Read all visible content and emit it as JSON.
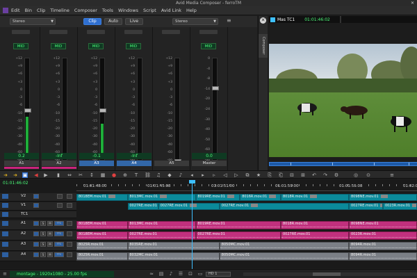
{
  "window": {
    "title": "Avid Media Composer - ferroTM"
  },
  "menu": [
    "Edit",
    "Bin",
    "Clip",
    "Timeline",
    "Composer",
    "Tools",
    "Windows",
    "Script",
    "Avid Link",
    "Help"
  ],
  "mixer": {
    "mode_left": "Stereo",
    "mode_right": "Stereo",
    "buttons": [
      "Clip",
      "Auto",
      "Live"
    ],
    "active_button": "Clip",
    "scale": [
      "+12",
      "+9",
      "+6",
      "+3",
      "0",
      "-3",
      "-6",
      "-10",
      "-15",
      "-20",
      "-30",
      "-40",
      "-60",
      "-oo"
    ],
    "master_scale": [
      "0",
      "-4",
      "-8",
      "-14",
      "-20",
      "-24",
      "-30",
      "-40",
      "-50",
      "-60",
      "-oo"
    ],
    "strips": [
      {
        "mode": "MID",
        "value": "0.2",
        "name": "A1",
        "selected": false,
        "fader": 0.5,
        "level": 0.42,
        "colored": true
      },
      {
        "mode": "MID",
        "value": "-Inf",
        "name": "A2",
        "selected": false,
        "fader": 0.05,
        "level": 0.0,
        "colored": true
      },
      {
        "mode": "MID",
        "value": "-0.1",
        "name": "A3",
        "selected": true,
        "fader": 0.5,
        "level": 0.35,
        "colored": false
      },
      {
        "mode": "MID",
        "value": "-Inf",
        "name": "A4",
        "selected": true,
        "fader": 0.05,
        "level": 0.0,
        "colored": false
      },
      {
        "mode": "",
        "value": "",
        "name": "A5",
        "selected": false,
        "fader": 0.0,
        "level": 0.0,
        "colored": false
      },
      {
        "mode": "MID",
        "value": "0.0",
        "name": "Master",
        "selected": false,
        "fader": 0.72,
        "level": 0.0,
        "colored": false
      }
    ]
  },
  "composer": {
    "tab": "Composer",
    "track": "Mas TC1",
    "timecode": "01:01:46:02"
  },
  "timeline": {
    "timecode": "01:01:46:02",
    "ruler": [
      "01:01:48:00",
      "01:01:45:08",
      "01:01:51:00",
      "01:01:59:00",
      "01:01:55:08",
      "01:02:00"
    ],
    "tracks": [
      {
        "name": "V2",
        "kind": "video",
        "clips": [
          {
            "label": "8018EM.mov.01",
            "start": 0.0,
            "end": 0.15
          },
          {
            "label": "8013MC.mov.01",
            "start": 0.15,
            "end": 0.35
          },
          {
            "label": "8019RE.mov.01",
            "start": 0.35,
            "end": 0.48
          },
          {
            "label": "8016R.mov.01",
            "start": 0.48,
            "end": 0.6
          },
          {
            "label": "8018R.mov.01",
            "start": 0.6,
            "end": 0.8
          },
          {
            "label": "8098NE.mov.01",
            "start": 0.8,
            "end": 1.0
          }
        ]
      },
      {
        "name": "V1",
        "kind": "video",
        "clips": [
          {
            "label": "0027RE.mov.01",
            "start": 0.15,
            "end": 0.24
          },
          {
            "label": "0027RE.mov.01",
            "start": 0.24,
            "end": 0.42
          },
          {
            "label": "0027RE.mov.01",
            "start": 0.42,
            "end": 0.8
          },
          {
            "label": "0027RE.mov.01",
            "start": 0.8,
            "end": 0.9
          },
          {
            "label": "0023R.mov.01",
            "start": 0.9,
            "end": 1.0
          }
        ]
      },
      {
        "name": "TC1",
        "kind": "timecode",
        "clips": []
      },
      {
        "name": "A1",
        "kind": "audio",
        "clips": [
          {
            "label": "8018EM.mov.01",
            "start": 0.0,
            "end": 0.15
          },
          {
            "label": "8013MC.mov.01",
            "start": 0.15,
            "end": 0.35
          },
          {
            "label": "8019RE.mov.01",
            "start": 0.35,
            "end": 0.6
          },
          {
            "label": "8018R.mov.01",
            "start": 0.6,
            "end": 0.8
          },
          {
            "label": "8098NE.mov.01",
            "start": 0.8,
            "end": 1.0
          }
        ]
      },
      {
        "name": "A2",
        "kind": "audio",
        "clips": [
          {
            "label": "8018EM.mov.01",
            "start": 0.0,
            "end": 0.15
          },
          {
            "label": "0027RE.mov.01",
            "start": 0.15,
            "end": 0.35
          },
          {
            "label": "0027RE.mov.01",
            "start": 0.35,
            "end": 0.6
          },
          {
            "label": "0027RE.mov.01",
            "start": 0.6,
            "end": 0.8
          },
          {
            "label": "0023R.mov.01",
            "start": 0.8,
            "end": 1.0
          }
        ]
      },
      {
        "name": "A3",
        "kind": "audio-grey",
        "clips": [
          {
            "label": "8025R.mov.01",
            "start": 0.0,
            "end": 0.15
          },
          {
            "label": "8035RE.mov.01",
            "start": 0.15,
            "end": 0.42
          },
          {
            "label": "8050MC.mov.01",
            "start": 0.42,
            "end": 0.8
          },
          {
            "label": "8094R.mov.01",
            "start": 0.8,
            "end": 1.0
          }
        ]
      },
      {
        "name": "A4",
        "kind": "audio-grey",
        "clips": [
          {
            "label": "8025R.mov.01",
            "start": 0.0,
            "end": 0.15
          },
          {
            "label": "8032MC.mov.01",
            "start": 0.15,
            "end": 0.42
          },
          {
            "label": "8050MC.mov.01",
            "start": 0.42,
            "end": 0.8
          },
          {
            "label": "8094R.mov.01",
            "start": 0.8,
            "end": 1.0
          }
        ]
      }
    ],
    "track_buttons": [
      "S",
      "M",
      "TTC"
    ]
  },
  "sequence": {
    "info": "montage - 1920x1080 - 25.00 fps",
    "zoom_label": "HD 1"
  },
  "colors": {
    "accent": "#2f6fd0",
    "video": "#0b8a9a",
    "audio": "#c2307e",
    "timecode": "#4cff7a"
  }
}
